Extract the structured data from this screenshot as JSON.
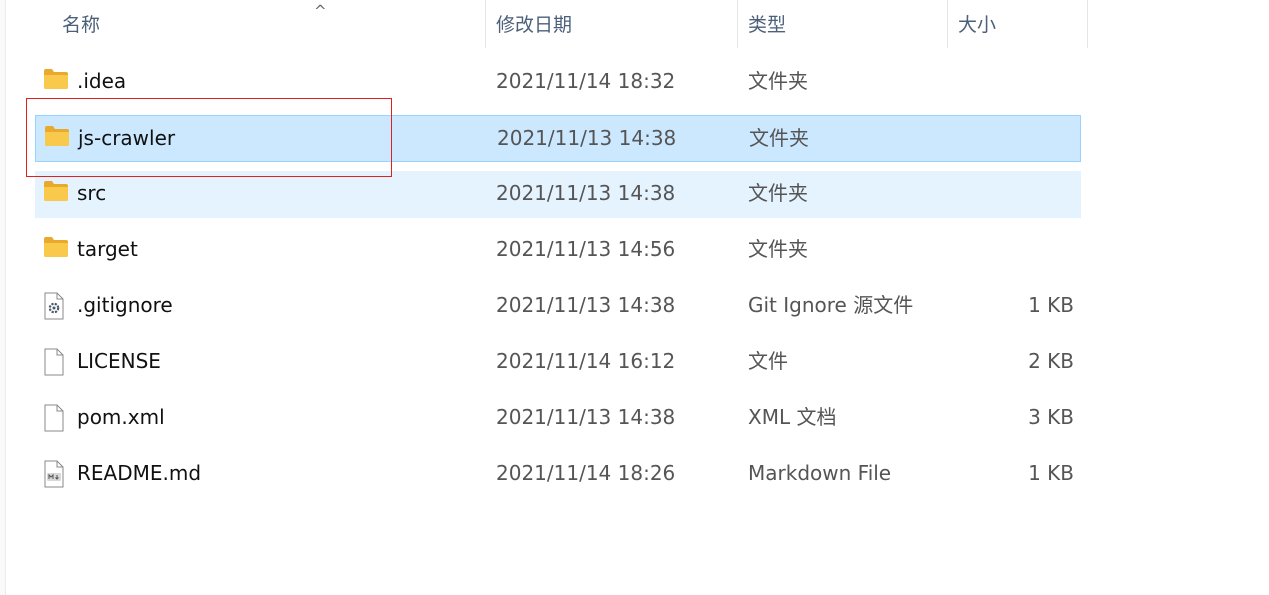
{
  "columns": {
    "name": "名称",
    "date": "修改日期",
    "type": "类型",
    "size": "大小"
  },
  "sort_indicator": "^",
  "files": [
    {
      "name": ".idea",
      "date": "2021/11/14 18:32",
      "type": "文件夹",
      "size": "",
      "icon": "folder-icon",
      "state": "normal"
    },
    {
      "name": "js-crawler",
      "date": "2021/11/13 14:38",
      "type": "文件夹",
      "size": "",
      "icon": "folder-icon",
      "state": "selected"
    },
    {
      "name": "src",
      "date": "2021/11/13 14:38",
      "type": "文件夹",
      "size": "",
      "icon": "folder-icon",
      "state": "hover"
    },
    {
      "name": "target",
      "date": "2021/11/13 14:56",
      "type": "文件夹",
      "size": "",
      "icon": "folder-icon",
      "state": "normal"
    },
    {
      "name": ".gitignore",
      "date": "2021/11/13 14:38",
      "type": "Git Ignore 源文件",
      "size": "1 KB",
      "icon": "settings-file-icon",
      "state": "normal"
    },
    {
      "name": "LICENSE",
      "date": "2021/11/14 16:12",
      "type": "文件",
      "size": "2 KB",
      "icon": "blank-file-icon",
      "state": "normal"
    },
    {
      "name": "pom.xml",
      "date": "2021/11/13 14:38",
      "type": "XML 文档",
      "size": "3 KB",
      "icon": "blank-file-icon",
      "state": "normal"
    },
    {
      "name": "README.md",
      "date": "2021/11/14 18:26",
      "type": "Markdown File",
      "size": "1 KB",
      "icon": "markdown-file-icon",
      "state": "normal"
    }
  ],
  "colors": {
    "selected_bg": "#cce8ff",
    "selected_border": "#99d1ff",
    "hover_bg": "#e5f3ff",
    "annotation_red": "#e0201c",
    "folder_yellow": "#f8c94a"
  }
}
